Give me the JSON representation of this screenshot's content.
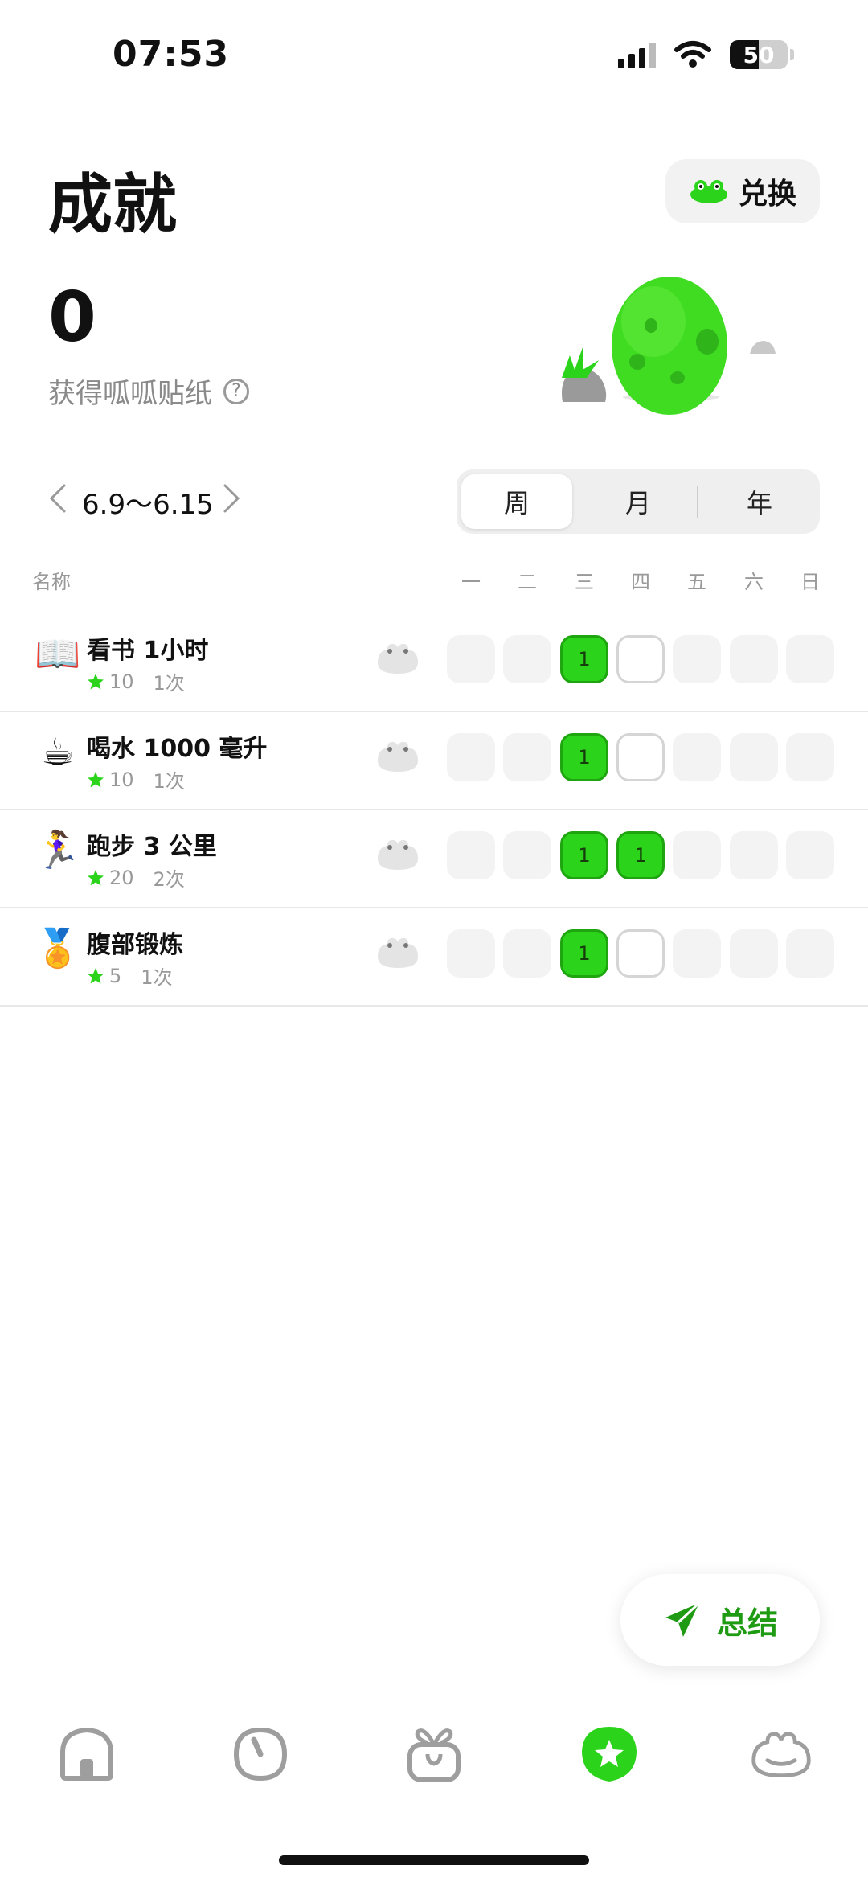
{
  "status_bar": {
    "time": "07:53",
    "battery": "50"
  },
  "header": {
    "title": "成就",
    "exchange_label": "兑换"
  },
  "stats": {
    "count": "0",
    "label": "获得呱呱贴纸",
    "help": "?"
  },
  "date_nav": {
    "range": "6.9～6.15"
  },
  "period_tabs": [
    {
      "label": "周",
      "active": true
    },
    {
      "label": "月",
      "active": false
    },
    {
      "label": "年",
      "active": false
    }
  ],
  "table": {
    "name_header": "名称",
    "days": [
      "一",
      "二",
      "三",
      "四",
      "五",
      "六",
      "日"
    ],
    "rows": [
      {
        "emoji": "📖",
        "name": "看书 1小时",
        "points": "10",
        "count": "1次",
        "cells": [
          "",
          "",
          "1",
          "",
          "",
          "",
          ""
        ],
        "states": [
          "empty",
          "empty",
          "done",
          "today",
          "empty",
          "empty",
          "empty"
        ]
      },
      {
        "emoji": "☕",
        "name": "喝水 1000 毫升",
        "points": "10",
        "count": "1次",
        "cells": [
          "",
          "",
          "1",
          "",
          "",
          "",
          ""
        ],
        "states": [
          "empty",
          "empty",
          "done",
          "today",
          "empty",
          "empty",
          "empty"
        ]
      },
      {
        "emoji": "🏃‍♀️",
        "name": "跑步 3 公里",
        "points": "20",
        "count": "2次",
        "cells": [
          "",
          "",
          "1",
          "1",
          "",
          "",
          ""
        ],
        "states": [
          "empty",
          "empty",
          "done",
          "done",
          "empty",
          "empty",
          "empty"
        ]
      },
      {
        "emoji": "🏅",
        "name": "腹部锻炼",
        "points": "5",
        "count": "1次",
        "cells": [
          "",
          "",
          "1",
          "",
          "",
          "",
          ""
        ],
        "states": [
          "empty",
          "empty",
          "done",
          "today",
          "empty",
          "empty",
          "empty"
        ]
      }
    ]
  },
  "summary_button": {
    "label": "总结"
  },
  "tab_bar": [
    {
      "icon": "home-icon",
      "active": false
    },
    {
      "icon": "timer-icon",
      "active": false
    },
    {
      "icon": "gift-icon",
      "active": false
    },
    {
      "icon": "star-badge-icon",
      "active": true
    },
    {
      "icon": "frog-icon",
      "active": false
    }
  ],
  "colors": {
    "accent_green": "#2bd41b",
    "text_gray": "#8a8a8a"
  }
}
